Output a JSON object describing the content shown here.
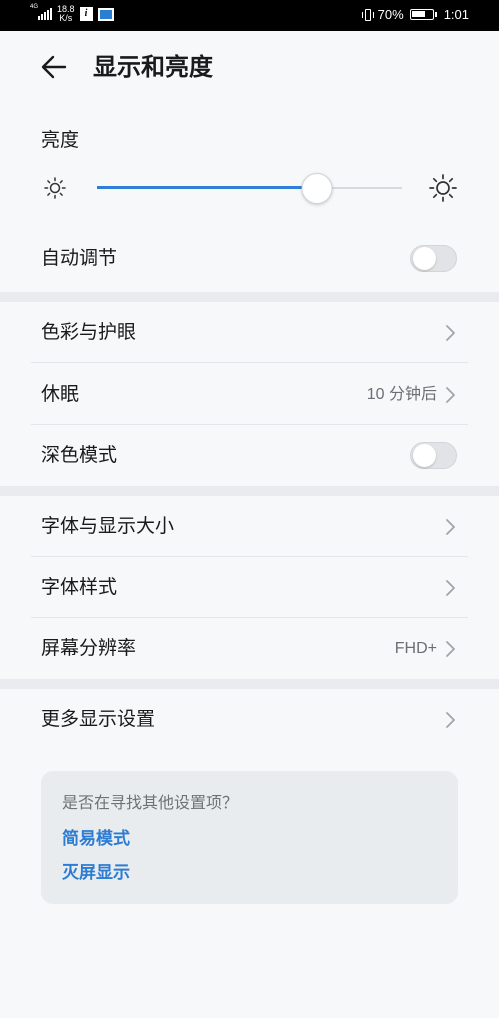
{
  "status_bar": {
    "network_tag": "4G",
    "speed_value": "18.8",
    "speed_unit": "K/s",
    "battery_percent": "70%",
    "battery_level": 0.7,
    "time": "1:01"
  },
  "header": {
    "title": "显示和亮度"
  },
  "brightness": {
    "label": "亮度",
    "level_percent": 72
  },
  "auto_adjust": {
    "label": "自动调节",
    "enabled": false
  },
  "section_eye": {
    "color_eye_label": "色彩与护眼",
    "sleep_label": "休眠",
    "sleep_value": "10 分钟后",
    "dark_mode_label": "深色模式",
    "dark_mode_enabled": false
  },
  "section_font": {
    "font_size_label": "字体与显示大小",
    "font_style_label": "字体样式",
    "resolution_label": "屏幕分辨率",
    "resolution_value": "FHD+"
  },
  "section_more": {
    "more_label": "更多显示设置"
  },
  "suggestions": {
    "question": "是否在寻找其他设置项？",
    "links": [
      "简易模式",
      "灭屏显示"
    ]
  },
  "colors": {
    "accent": "#2f7ed8",
    "link": "#2c7cd3",
    "background": "#f6f8fa"
  }
}
